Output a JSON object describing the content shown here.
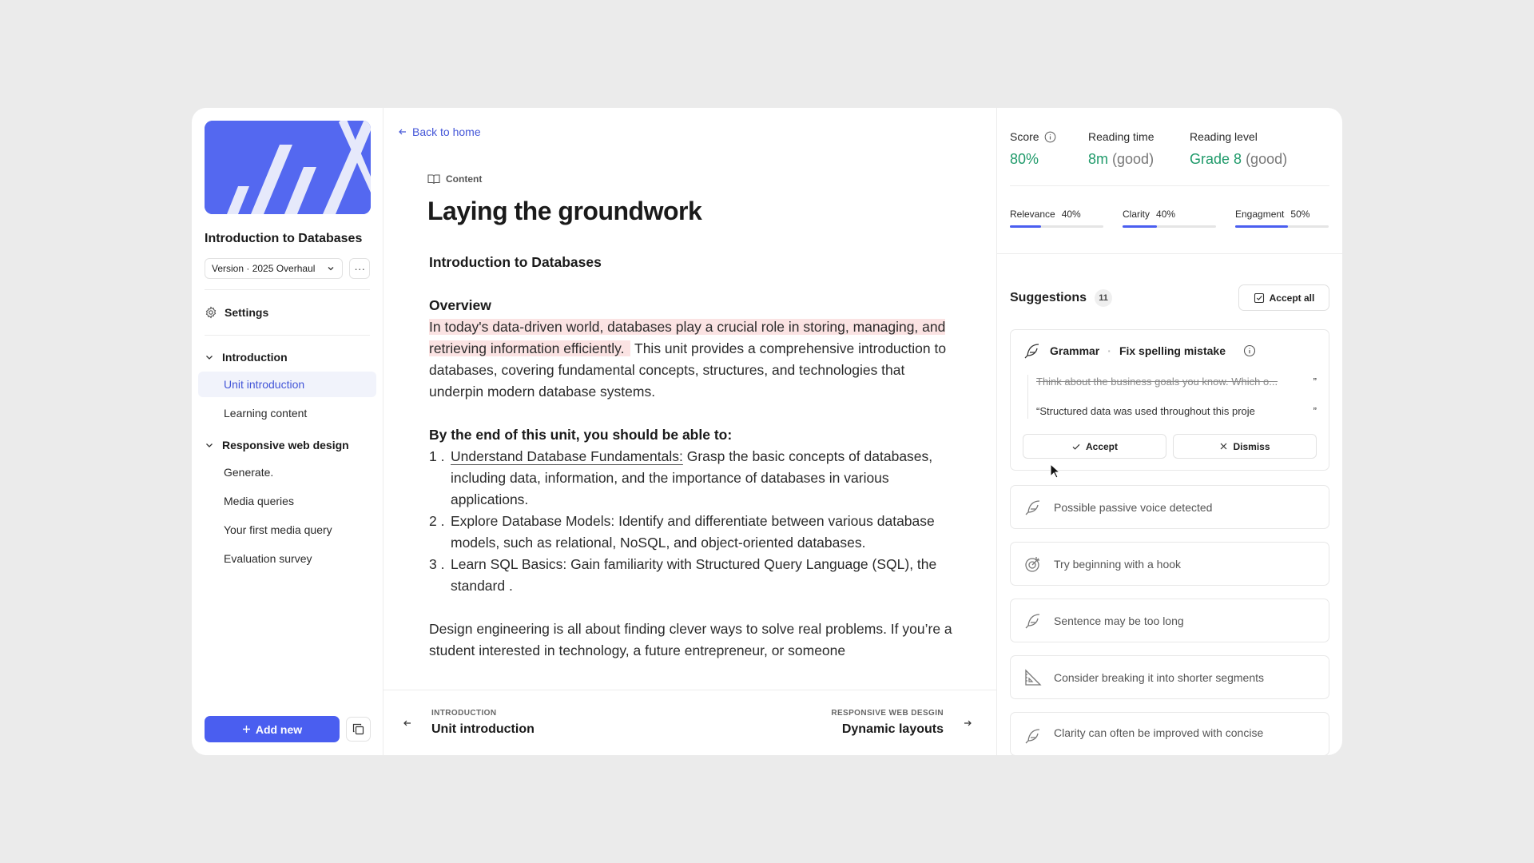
{
  "sidebar": {
    "course_title": "Introduction to Databases",
    "version_label": "Version · 2025 Overhaul",
    "more_label": "···",
    "settings_label": "Settings",
    "sections": [
      {
        "title": "Introduction",
        "items": [
          "Unit introduction",
          "Learning content"
        ]
      },
      {
        "title": "Responsive web design",
        "items": [
          "Generate.",
          "Media queries",
          "Your first media query",
          "Evaluation survey"
        ]
      }
    ],
    "active_item": "Unit introduction",
    "add_label": "Add new"
  },
  "main": {
    "back_label": "Back to home",
    "content_tag": "Content",
    "title": "Laying the groundwork",
    "subheading": "Introduction to Databases",
    "overview_heading": "Overview",
    "overview_highlight": "In today's data-driven world, databases play a crucial role in storing, managing, and retrieving information efficiently.",
    "overview_rest": " This unit provides a comprehensive introduction to databases, covering fundamental concepts, structures, and technologies that underpin modern database systems.",
    "objectives_heading": "By the end of this unit, you should be able to:",
    "objectives": [
      {
        "num": "1 .",
        "lead": "Understand Database Fundamentals:",
        "text": " Grasp the basic concepts of databases, including data, information, and the importance of databases in various applications."
      },
      {
        "num": "2 .",
        "lead": "",
        "text": "Explore Database Models: Identify and differentiate between various database models, such as relational, NoSQL, and object-oriented databases."
      },
      {
        "num": "3 .",
        "lead": "",
        "text": "Learn SQL Basics: Gain familiarity with Structured Query Language (SQL), the standard ."
      }
    ],
    "closing_paragraph": "Design engineering is all about finding clever ways to solve real problems. If you’re a student interested in technology, a future entrepreneur, or someone",
    "prev": {
      "section": "INTRODUCTION",
      "title": "Unit introduction"
    },
    "next": {
      "section": "RESPONSIVE WEB DESGIN",
      "title": "Dynamic layouts"
    }
  },
  "panel": {
    "score_label": "Score",
    "score_value": "80%",
    "reading_time_label": "Reading time",
    "reading_time_value": "8m",
    "reading_time_note": "(good)",
    "reading_level_label": "Reading level",
    "reading_level_value": "Grade 8",
    "reading_level_note": "(good)",
    "metrics": [
      {
        "label": "Relevance",
        "value": "40%",
        "fraction": 0.33
      },
      {
        "label": "Clarity",
        "value": "40%",
        "fraction": 0.37
      },
      {
        "label": "Engagment",
        "value": "50%",
        "fraction": 0.56
      }
    ],
    "suggestions_label": "Suggestions",
    "suggestions_count": "11",
    "accept_all_label": "Accept all",
    "active_card": {
      "category": "Grammar",
      "action": "Fix spelling mistake",
      "original": "Think about the business goals you know. Which o...",
      "replacement": "“Structured data was used throughout this proje",
      "accept_label": "Accept",
      "dismiss_label": "Dismiss"
    },
    "cards": [
      {
        "icon": "feather-icon",
        "label": "Possible passive voice detected"
      },
      {
        "icon": "target-icon",
        "label": "Try beginning with a hook"
      },
      {
        "icon": "feather-icon",
        "label": "Sentence may be too long"
      },
      {
        "icon": "ruler-triangle-icon",
        "label": "Consider breaking it into shorter segments"
      },
      {
        "icon": "feather-icon",
        "label": "Clarity can often be improved with concise"
      }
    ]
  },
  "colors": {
    "accent": "#4a5ef0",
    "good": "#1f9a6a",
    "highlight": "#fbe3e3"
  }
}
